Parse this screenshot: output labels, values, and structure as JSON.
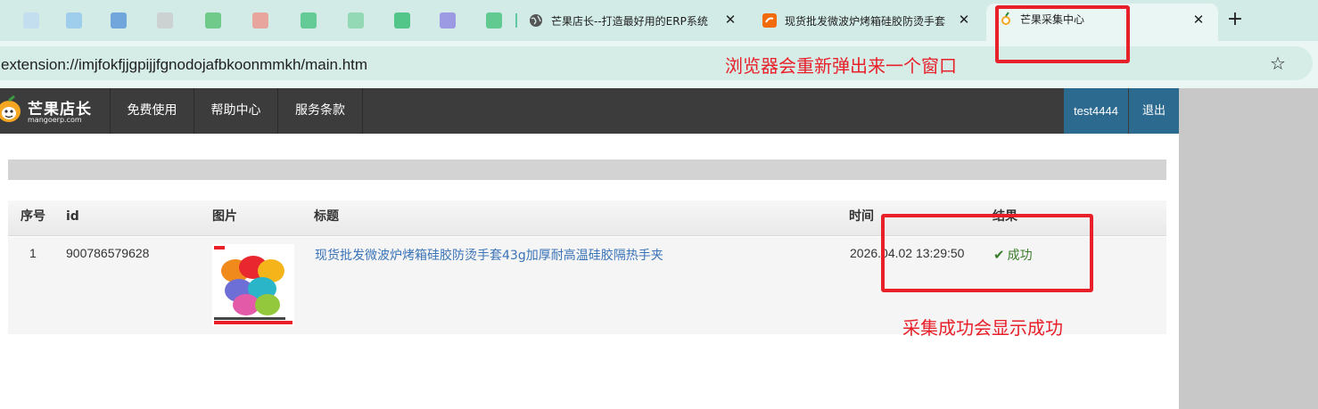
{
  "browser": {
    "tabs": [
      {
        "title": "芒果店长--打造最好用的ERP系统",
        "close": "✕",
        "favicon": "globe-icon"
      },
      {
        "title": "现货批发微波炉烤箱硅胶防烫手套",
        "close": "✕",
        "favicon": "alibaba-icon"
      },
      {
        "title": "芒果采集中心",
        "close": "✕",
        "favicon": "mango-icon"
      }
    ],
    "new_tab": "+",
    "url": "extension://imjfokfjjgpijjfgnodojafbkoonmmkh/main.htm",
    "bookmark_icon": "☆"
  },
  "navbar": {
    "logo_text": "芒果店长",
    "logo_sub": "mangoerp.com",
    "items": [
      {
        "label": "免费使用"
      },
      {
        "label": "帮助中心"
      },
      {
        "label": "服务条款"
      }
    ],
    "user": "test4444",
    "logout": "退出"
  },
  "table": {
    "headers": [
      "序号",
      "id",
      "图片",
      "标题",
      "时间",
      "结果"
    ],
    "rows": [
      {
        "index": "1",
        "id": "900786579628",
        "title": "现货批发微波炉烤箱硅胶防烫手套43g加厚耐高温硅胶隔热手夹",
        "time": "2026.04.02 13:29:50",
        "result": "成功",
        "result_icon": "✔"
      }
    ]
  },
  "annotations": {
    "popup_note": "浏览器会重新弹出来一个窗口",
    "success_note": "采集成功会显示成功"
  },
  "colors": {
    "annotation_red": "#e8202a",
    "navbar_bg": "#3c3c3c",
    "user_bg": "#2d6a8f",
    "link_blue": "#3a73b7",
    "success_green": "#3a7d2c"
  }
}
